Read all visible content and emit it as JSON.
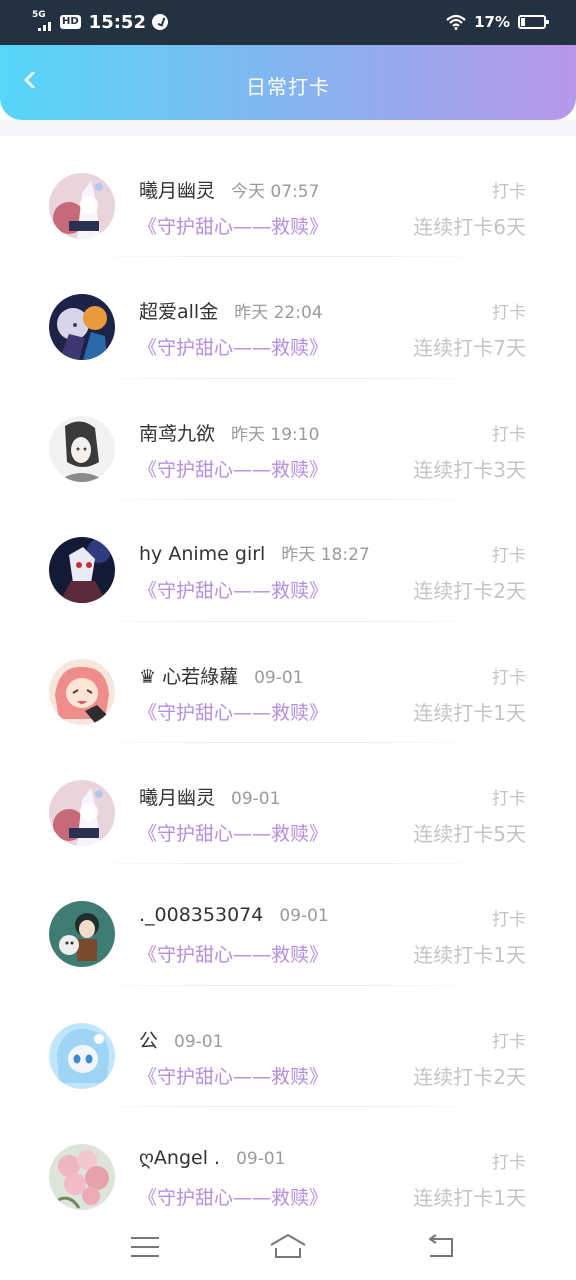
{
  "status_bar": {
    "network": "5G",
    "hd": "HD",
    "time": "15:52",
    "battery_percent": "17%",
    "battery_level": 0.17
  },
  "header": {
    "title": "日常打卡"
  },
  "colors": {
    "header_gradient": [
      "#56d6f8",
      "#b897ea"
    ],
    "book_title": "#b58ee2",
    "muted": "#c4c4c4",
    "status_bar_bg": "#233141"
  },
  "records": [
    {
      "name": "曦月幽灵",
      "time": "今天 07:57",
      "book": "《守护甜心——救赎》",
      "tag": "打卡",
      "streak": "连续打卡6天",
      "avatar": "avatar-anime-white"
    },
    {
      "name": "超爱all金",
      "time": "昨天 22:04",
      "book": "《守护甜心——救赎》",
      "tag": "打卡",
      "streak": "连续打卡7天",
      "avatar": "avatar-anime-duo"
    },
    {
      "name": "南鸢九欲",
      "time": "昨天 19:10",
      "book": "《守护甜心——救赎》",
      "tag": "打卡",
      "streak": "连续打卡3天",
      "avatar": "avatar-anime-sketch"
    },
    {
      "name": "hy Anime girl",
      "time": "昨天 18:27",
      "book": "《守护甜心——救赎》",
      "tag": "打卡",
      "streak": "连续打卡2天",
      "avatar": "avatar-anime-mask"
    },
    {
      "name": "♛ 心若綠蘿",
      "time": "09-01",
      "book": "《守护甜心——救赎》",
      "tag": "打卡",
      "streak": "连续打卡1天",
      "avatar": "avatar-anime-pink"
    },
    {
      "name": "曦月幽灵",
      "time": "09-01",
      "book": "《守护甜心——救赎》",
      "tag": "打卡",
      "streak": "连续打卡5天",
      "avatar": "avatar-anime-white"
    },
    {
      "name": "._008353074",
      "time": "09-01",
      "book": "《守护甜心——救赎》",
      "tag": "打卡",
      "streak": "连续打卡1天",
      "avatar": "avatar-anime-green"
    },
    {
      "name": "公",
      "time": "09-01",
      "book": "《守护甜心——救赎》",
      "tag": "打卡",
      "streak": "连续打卡2天",
      "avatar": "avatar-anime-blue"
    },
    {
      "name": "ღAngel .",
      "time": "09-01",
      "book": "《守护甜心——救赎》",
      "tag": "打卡",
      "streak": "连续打卡1天",
      "avatar": "avatar-flowers"
    }
  ],
  "nav": {
    "icons": [
      "menu-icon",
      "home-icon",
      "back-icon"
    ]
  }
}
